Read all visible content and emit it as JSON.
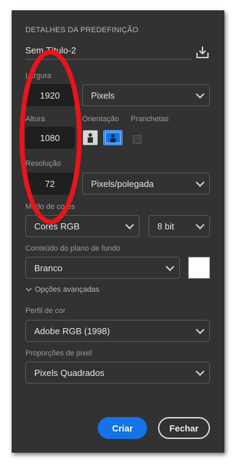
{
  "preset": {
    "section_title": "DETALHES DA PREDEFINIÇÃO",
    "name_value": "Sem Título-2",
    "save_icon": "download-save-icon"
  },
  "dimensions": {
    "width_label": "Largura",
    "width_value": "1920",
    "width_unit": "Pixels",
    "height_label": "Altura",
    "height_value": "1080",
    "orientation_label": "Orientação",
    "orientation_selected": "landscape",
    "artboards_label": "Pranchetas",
    "artboards_checked": false
  },
  "resolution": {
    "label": "Resolução",
    "value": "72",
    "unit": "Pixels/polegada"
  },
  "color_mode": {
    "label": "Modo de cores",
    "value": "Cores RGB",
    "bit_depth": "8 bit"
  },
  "background": {
    "label": "Conteúdo do plano de fundo",
    "value": "Branco",
    "swatch_color": "#ffffff"
  },
  "advanced": {
    "toggle_label": "Opções avançadas",
    "color_profile_label": "Perfil de cor",
    "color_profile_value": "Adobe RGB (1998)",
    "pixel_aspect_label": "Proporções de pixel",
    "pixel_aspect_value": "Pixels Quadrados"
  },
  "actions": {
    "create_label": "Criar",
    "close_label": "Fechar"
  },
  "annotation_color": "#e8151b"
}
